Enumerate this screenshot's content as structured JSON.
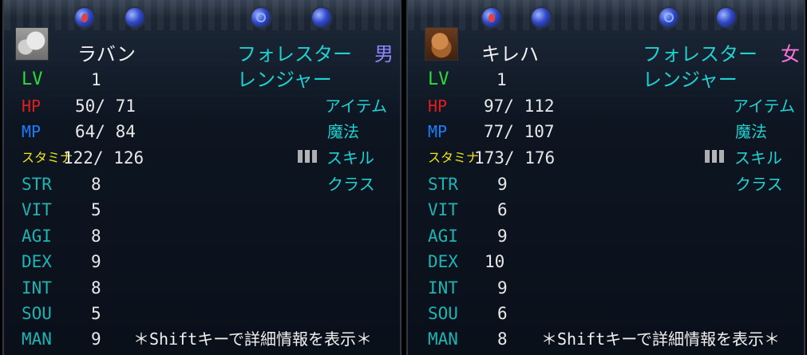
{
  "characters": [
    {
      "name": "ラバン",
      "class_line1": "フォレスター",
      "class_line2": "レンジャー",
      "gender": "男",
      "lv": "1",
      "hp": "50/ 71",
      "mp": "64/ 84",
      "stamina": "122/ 126",
      "stats": {
        "STR": "8",
        "VIT": "5",
        "AGI": "8",
        "DEX": "9",
        "INT": "8",
        "SOU": "5",
        "MAN": "9"
      }
    },
    {
      "name": "キレハ",
      "class_line1": "フォレスター",
      "class_line2": "レンジャー",
      "gender": "女",
      "lv": "1",
      "hp": "97/ 112",
      "mp": "77/ 107",
      "stamina": "173/ 176",
      "stats": {
        "STR": "9",
        "VIT": "6",
        "AGI": "9",
        "DEX": "10",
        "INT": "9",
        "SOU": "6",
        "MAN": "8"
      }
    }
  ],
  "labels": {
    "lv": "LV",
    "hp": "HP",
    "mp": "MP",
    "stamina": "スタミナ",
    "str": "STR",
    "vit": "VIT",
    "agi": "AGI",
    "dex": "DEX",
    "int": "INT",
    "sou": "SOU",
    "man": "MAN"
  },
  "menu": {
    "item": "アイテム",
    "magic": "魔法",
    "skill": "スキル",
    "class": "クラス"
  },
  "hint": "＊Shiftキーで詳細情報を表示＊",
  "colors": {
    "lv_label": "#2bdc3c",
    "hp_label": "#e11d1d",
    "mp_label": "#1c7cff",
    "stamina_label": "#f1e316",
    "stat_label": "#1eb4b4",
    "menu_text": "#1fd1d1",
    "male_symbol": "#8d87ff",
    "female_symbol": "#ff73db"
  },
  "icons": {
    "left_portrait": "wolf-portrait-icon",
    "right_portrait": "fox-portrait-icon",
    "skill_icon": "skill-arrow-icon",
    "top_orb": "magic-orb-icon"
  }
}
